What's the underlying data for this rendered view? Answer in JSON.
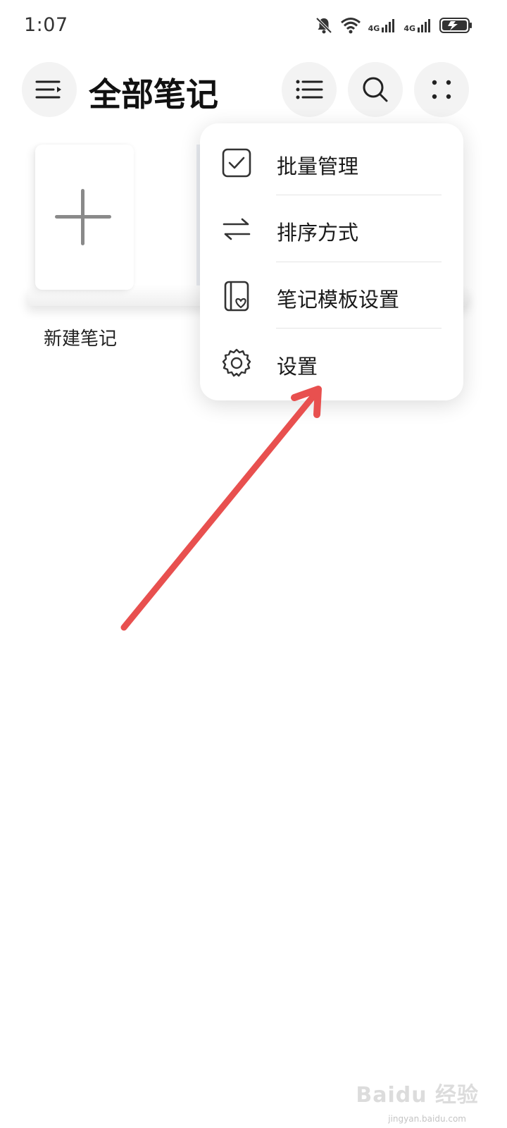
{
  "status_bar": {
    "time": "1:07",
    "network_label_1": "4G",
    "network_label_2": "4G"
  },
  "header": {
    "title": "全部笔记"
  },
  "notes": {
    "new_note_label": "新建笔记"
  },
  "menu": {
    "items": [
      {
        "label": "批量管理",
        "icon": "checkbox-icon"
      },
      {
        "label": "排序方式",
        "icon": "sort-arrows-icon"
      },
      {
        "label": "笔记模板设置",
        "icon": "notebook-template-icon"
      },
      {
        "label": "设置",
        "icon": "gear-icon"
      }
    ]
  },
  "annotation": {
    "arrow_color": "#e8504f"
  },
  "watermark": {
    "text": "Baidu 经验",
    "subtext": "jingyan.baidu.com"
  },
  "colors": {
    "button_bg": "#f3f3f3",
    "icon_color": "#333333",
    "menu_bg": "#ffffff"
  }
}
